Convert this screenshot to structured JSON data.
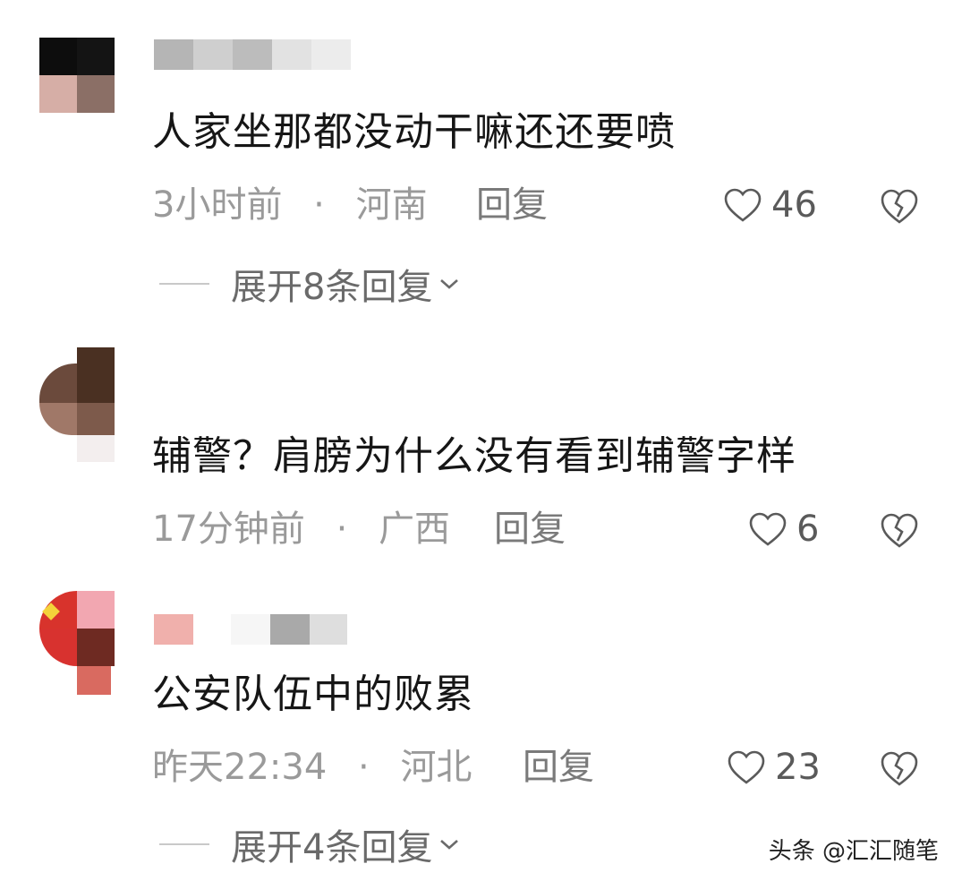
{
  "comments": [
    {
      "text": "人家坐那都没动干嘛还还要喷",
      "time": "3小时前",
      "separator": "·",
      "location": "河南",
      "reply_label": "回复",
      "likes": "46",
      "expand_label": "展开8条回复"
    },
    {
      "text": "辅警？肩膀为什么没有看到辅警字样",
      "time": "17分钟前",
      "separator": "·",
      "location": "广西",
      "reply_label": "回复",
      "likes": "6",
      "expand_label": ""
    },
    {
      "text": "公安队伍中的败累",
      "time": "昨天22:34",
      "separator": "·",
      "location": "河北",
      "reply_label": "回复",
      "likes": "23",
      "expand_label": "展开4条回复"
    }
  ],
  "watermark": "头条 @汇汇随笔",
  "icons": {
    "like": "heart-outline-icon",
    "dislike": "broken-heart-icon",
    "expand": "chevron-down-icon"
  },
  "colors": {
    "text": "#161616",
    "meta": "#9a9a9a",
    "icon": "#5a5a5a"
  }
}
